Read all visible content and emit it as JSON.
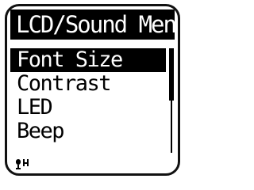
{
  "menu": {
    "title": "LCD/Sound Menu",
    "items": [
      {
        "label": "Font Size",
        "selected": true
      },
      {
        "label": "Contrast",
        "selected": false
      },
      {
        "label": "LED",
        "selected": false
      },
      {
        "label": "Beep",
        "selected": false
      }
    ]
  },
  "scrollbar": {
    "position_fraction": 0.0,
    "visible_fraction": 0.5
  },
  "status": {
    "icon": "microphone-high-sensitivity-icon"
  },
  "colors": {
    "background": "#ffffff",
    "foreground": "#000000",
    "highlight": "#000000",
    "highlight_text": "#ffffff"
  }
}
